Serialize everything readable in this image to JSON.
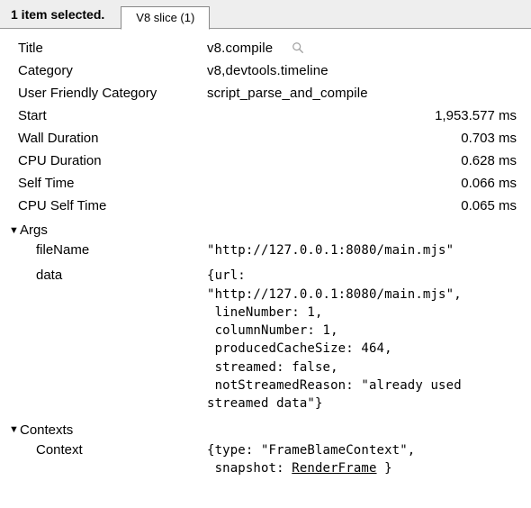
{
  "header": {
    "selection_text": "1 item selected.",
    "tab_label": "V8 slice (1)"
  },
  "details": {
    "title_label": "Title",
    "title_value": "v8.compile",
    "category_label": "Category",
    "category_value": "v8,devtools.timeline",
    "user_friendly_label": "User Friendly Category",
    "user_friendly_value": "script_parse_and_compile",
    "start_label": "Start",
    "start_value": "1,953.577 ms",
    "wall_duration_label": "Wall Duration",
    "wall_duration_value": "0.703 ms",
    "cpu_duration_label": "CPU Duration",
    "cpu_duration_value": "0.628 ms",
    "self_time_label": "Self Time",
    "self_time_value": "0.066 ms",
    "cpu_self_time_label": "CPU Self Time",
    "cpu_self_time_value": "0.065 ms"
  },
  "args": {
    "header": "Args",
    "fileName_label": "fileName",
    "fileName_value": "\"http://127.0.0.1:8080/main.mjs\"",
    "data_label": "data",
    "data_value": "{url:\n\"http://127.0.0.1:8080/main.mjs\",\n lineNumber: 1,\n columnNumber: 1,\n producedCacheSize: 464,\n streamed: false,\n notStreamedReason: \"already used\nstreamed data\"}"
  },
  "contexts": {
    "header": "Contexts",
    "context_label": "Context",
    "context_prefix": "{type: \"FrameBlameContext\",\n snapshot: ",
    "context_link": "RenderFrame",
    "context_suffix": " }"
  },
  "icons": {
    "magnify": "magnify-icon"
  }
}
